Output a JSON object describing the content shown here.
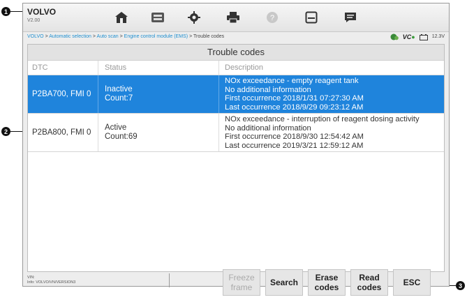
{
  "callouts": [
    "1",
    "2",
    "3"
  ],
  "toolbar": {
    "brand": "VOLVO",
    "version": "V2.00",
    "buttons": [
      "home-icon",
      "vehicle-swap-icon",
      "settings-icon",
      "printer-icon",
      "help-icon",
      "save-icon",
      "message-icon"
    ]
  },
  "breadcrumb": {
    "items": [
      "VOLVO",
      "Automatic selection",
      "Auto scan",
      "Engine control module (EMS)",
      "Trouble codes"
    ],
    "separator": ">"
  },
  "status": {
    "vci_label": "VC",
    "battery": "12.3V"
  },
  "panel": {
    "title": "Trouble codes",
    "columns": {
      "dtc": "DTC",
      "status": "Status",
      "description": "Description"
    },
    "rows": [
      {
        "dtc": "P2BA700, FMI 0",
        "status": "Inactive",
        "count": "Count:7",
        "desc": [
          "NOx exceedance - empty reagent tank",
          "No additional information",
          "First occurrence 2018/1/31 07:27:30 AM",
          "Last occurrence 2018/9/29 09:23:12 AM"
        ]
      },
      {
        "dtc": "P2BA800, FMI 0",
        "status": "Active",
        "count": "Count:69",
        "desc": [
          "NOx exceedance - interruption of reagent dosing activity",
          "No additional information",
          "First occurrence 2018/9/30 12:54:42 AM",
          "Last occurrence 2019/3/21 12:59:12 AM"
        ]
      }
    ]
  },
  "footer": {
    "vin_label": "VIN:",
    "info": "Info: VOLVO/VN/VERSION3",
    "buttons": {
      "freeze_line1": "Freeze",
      "freeze_line2": "frame",
      "search": "Search",
      "erase_line1": "Erase",
      "erase_line2": "codes",
      "read_line1": "Read",
      "read_line2": "codes",
      "esc": "ESC"
    }
  },
  "colors": {
    "selected_row": "#1f84dc",
    "link": "#1f8fd0"
  }
}
